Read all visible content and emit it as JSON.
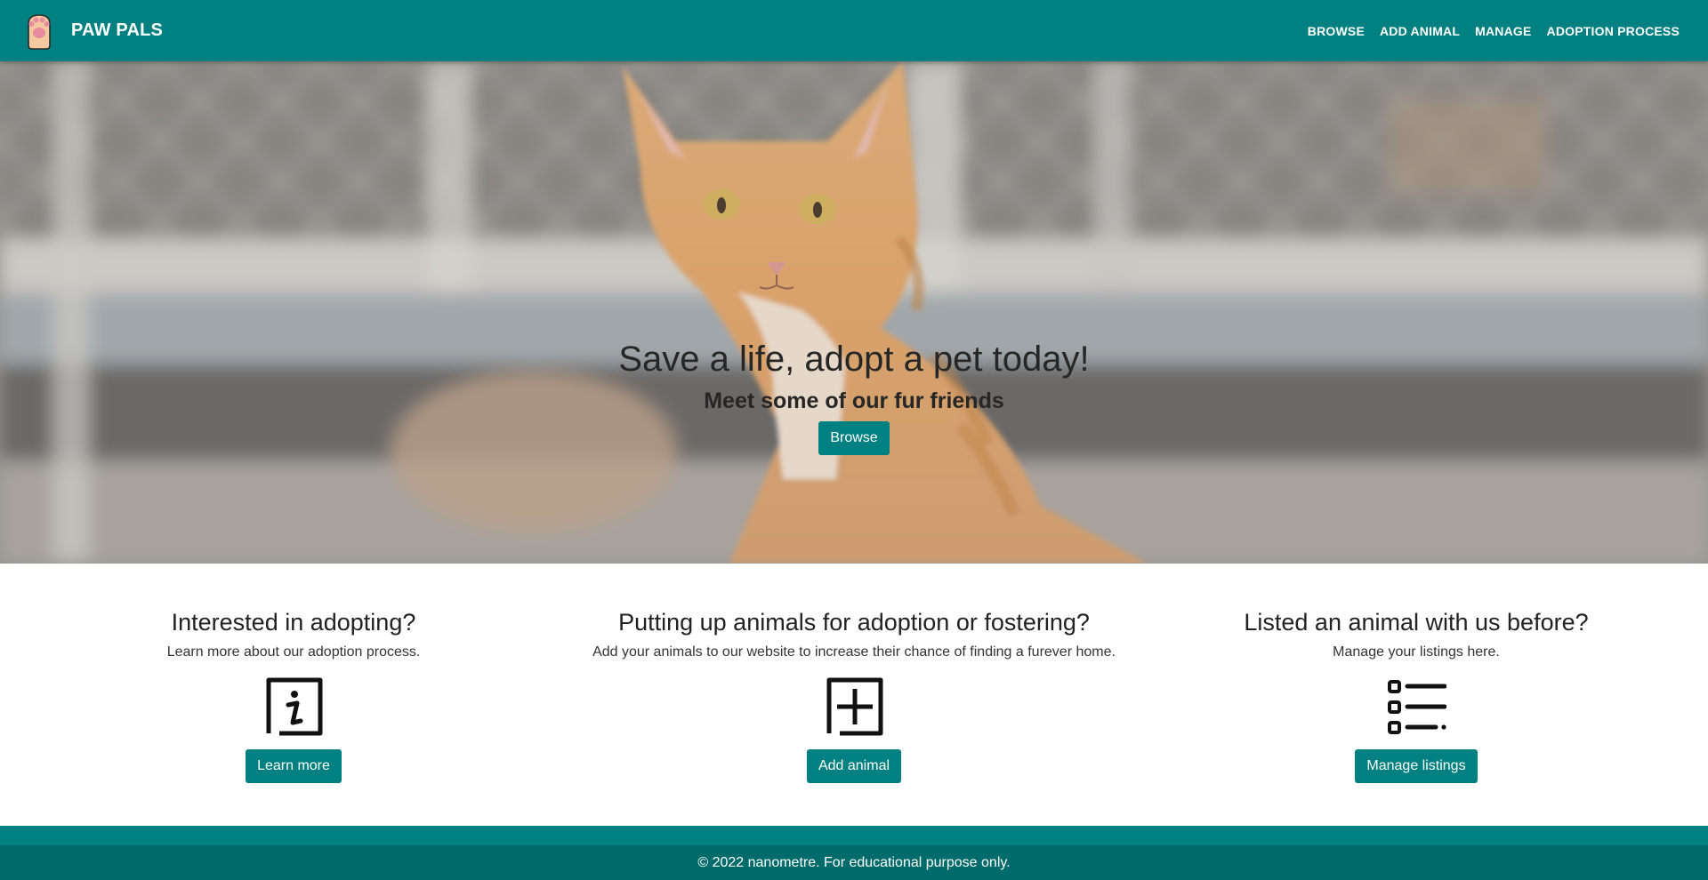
{
  "brand": {
    "name": "PAW PALS",
    "logo_icon": "paw-icon"
  },
  "nav": {
    "items": [
      {
        "label": "BROWSE"
      },
      {
        "label": "ADD ANIMAL"
      },
      {
        "label": "MANAGE"
      },
      {
        "label": "ADOPTION PROCESS"
      }
    ]
  },
  "hero": {
    "title": "Save a life, adopt a pet today!",
    "subtitle": "Meet some of our fur friends",
    "button_label": "Browse"
  },
  "features": [
    {
      "title": "Interested in adopting?",
      "description": "Learn more about our adoption process.",
      "icon": "info-icon",
      "button_label": "Learn more"
    },
    {
      "title": "Putting up animals for adoption or fostering?",
      "description": "Add your animals to our website to increase their chance of finding a furever home.",
      "icon": "plus-square-icon",
      "button_label": "Add animal"
    },
    {
      "title": "Listed an animal with us before?",
      "description": "Manage your listings here.",
      "icon": "list-icon",
      "button_label": "Manage listings"
    }
  ],
  "footer": {
    "text": "© 2022 nanometre. For educational purpose only."
  },
  "colors": {
    "primary": "#008080",
    "footer_dark": "#006b6b",
    "text": "#222222"
  }
}
